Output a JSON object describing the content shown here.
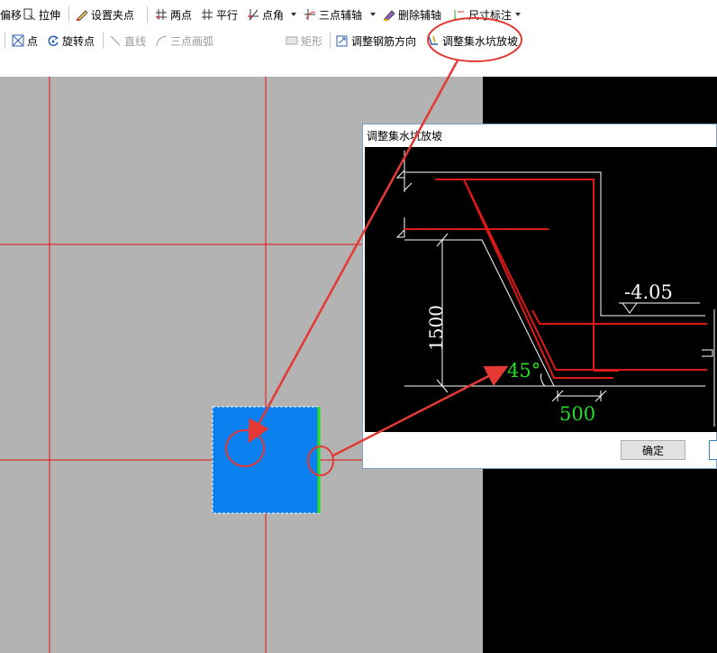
{
  "toolbar_row1": {
    "offset_label": "偏移",
    "stretch_label": "拉伸",
    "set_grip_label": "设置夹点",
    "two_point_label": "两点",
    "parallel_label": "平行",
    "point_angle_label": "点角",
    "three_point_axis_label": "三点辅轴",
    "delete_axis_label": "删除辅轴",
    "dimension_label": "尺寸标注"
  },
  "toolbar_row2": {
    "point_label": "点",
    "rotate_point_label": "旋转点",
    "line_label": "直线",
    "three_point_arc_label": "三点画弧",
    "shape_select_value": "",
    "rectangle_label": "矩形",
    "adjust_rebar_dir_label": "调整钢筋方向",
    "adjust_sump_slope_label": "调整集水坑放坡"
  },
  "dialog": {
    "title": "调整集水坑放坡",
    "dim_depth": "1500",
    "dim_elevation": "-4.05",
    "dim_angle": "45°",
    "dim_width": "500",
    "ok_label": "确定"
  },
  "colors": {
    "annotation_red": "#e53935",
    "sump_blue": "#0a7fee",
    "edge_green": "#22e022",
    "grid_red": "#e01010",
    "rebar_red": "#e01818",
    "cad_green": "#22dd22"
  }
}
